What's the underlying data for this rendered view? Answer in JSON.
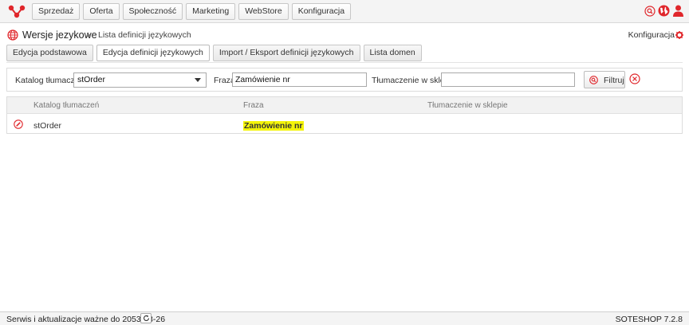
{
  "nav": [
    "Sprzedaż",
    "Oferta",
    "Społeczność",
    "Marketing",
    "WebStore",
    "Konfiguracja"
  ],
  "header": {
    "title": "Wersje jezykowe",
    "breadcrumb": "Lista definicji językowych",
    "config_link": "Konfiguracja"
  },
  "tabs": [
    "Edycja podstawowa",
    "Edycja definicji językowych",
    "Import / Eksport definicji językowych",
    "Lista domen"
  ],
  "filter": {
    "catalog_label": "Katalog tłumaczeń",
    "catalog_value": "stOrder",
    "phrase_label": "Fraza",
    "phrase_value": "Zamówienie nr",
    "translation_label": "Tłumaczenie w sklepie",
    "translation_value": "",
    "filter_button": "Filtruj"
  },
  "table": {
    "headers": [
      "Katalog tłumaczeń",
      "Fraza",
      "Tłumaczenie w sklepie"
    ],
    "rows": [
      {
        "catalog": "stOrder",
        "phrase": "Zamówienie nr",
        "translation": ""
      }
    ]
  },
  "footer": {
    "service_text": "Serwis i aktualizacje ważne do 2053-08-26",
    "version": "SOTESHOP 7.2.8"
  },
  "colors": {
    "accent": "#e0262b",
    "highlight": "#f4f40a"
  },
  "icons": [
    "logo-icon",
    "search-icon",
    "globe-icon",
    "user-icon",
    "gear-icon",
    "edit-icon",
    "clear-icon",
    "refresh-icon"
  ]
}
